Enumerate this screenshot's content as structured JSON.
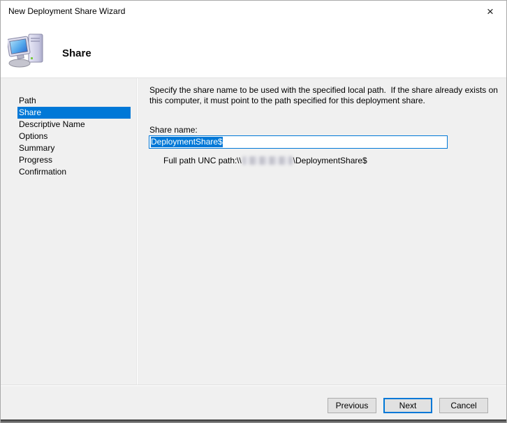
{
  "window": {
    "title": "New Deployment Share Wizard",
    "close_glyph": "×"
  },
  "header": {
    "title": "Share",
    "icon": "computer-icon"
  },
  "sidebar": {
    "items": [
      {
        "label": "Path",
        "active": false
      },
      {
        "label": "Share",
        "active": true
      },
      {
        "label": "Descriptive Name",
        "active": false
      },
      {
        "label": "Options",
        "active": false
      },
      {
        "label": "Summary",
        "active": false
      },
      {
        "label": "Progress",
        "active": false
      },
      {
        "label": "Confirmation",
        "active": false
      }
    ]
  },
  "content": {
    "instruction": "Specify the share name to be used with the specified local path.  If the share already exists on this computer, it must point to the path specified for this deployment share.",
    "share_name_label": "Share name:",
    "share_name_value": "DeploymentShare$",
    "unc_path_label": "Full path UNC path:",
    "unc_path_prefix": "\\\\",
    "unc_path_suffix": "\\DeploymentShare$"
  },
  "footer": {
    "previous_label": "Previous",
    "next_label": "Next",
    "cancel_label": "Cancel"
  },
  "colors": {
    "accent": "#0078d7",
    "selection_bg": "#0078d7",
    "body_bg": "#f0f0f0",
    "button_bg": "#e1e1e1",
    "button_border": "#adadad"
  }
}
